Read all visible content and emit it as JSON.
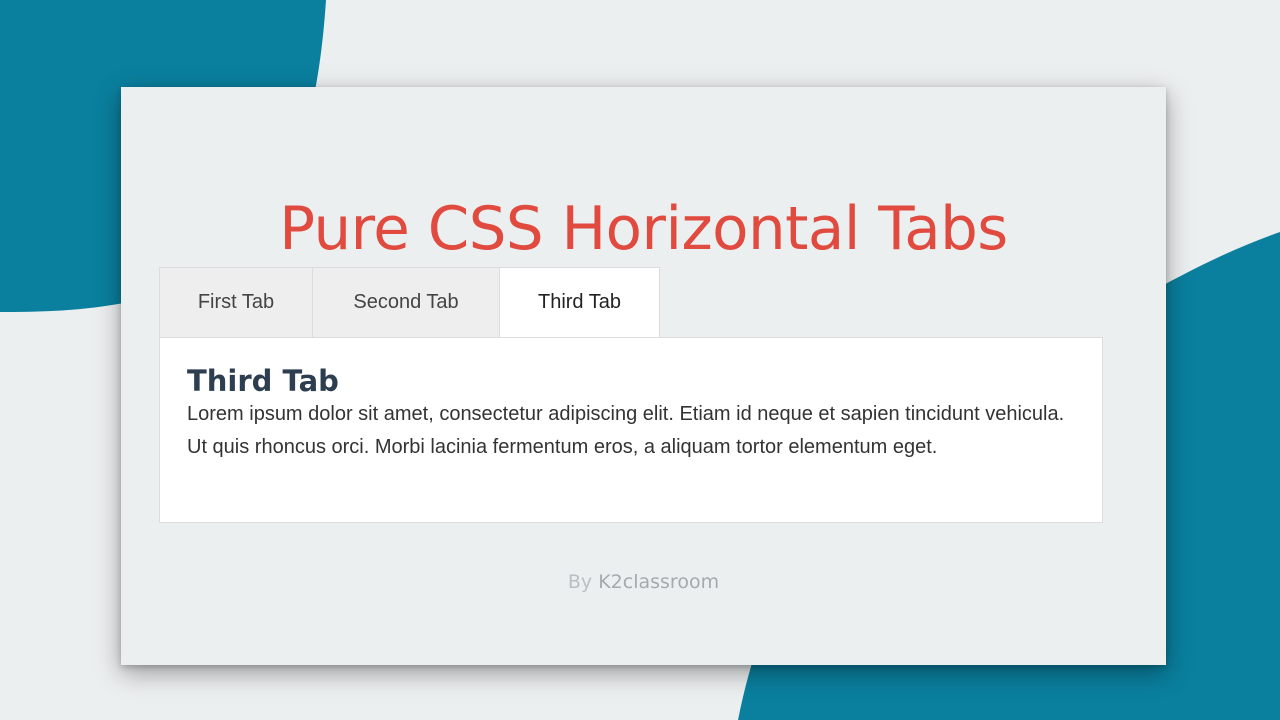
{
  "page": {
    "title": "Pure CSS Horizontal Tabs",
    "title_color": "#e04a3f",
    "background_accent": "#0a7f9e"
  },
  "tabs": [
    {
      "label": "First Tab",
      "active": false
    },
    {
      "label": "Second Tab",
      "active": false
    },
    {
      "label": "Third Tab",
      "active": true
    }
  ],
  "panel": {
    "heading": "Third Tab",
    "text": "Lorem ipsum dolor sit amet, consectetur adipiscing elit. Etiam id neque et sapien tincidunt vehicula. Ut quis rhoncus orci. Morbi lacinia fermentum eros, a aliquam tortor elementum eget."
  },
  "footer": {
    "by": "By",
    "author": "K2classroom"
  }
}
